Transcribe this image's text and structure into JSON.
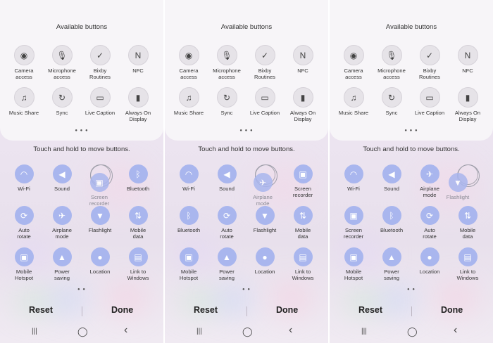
{
  "panels": [
    {
      "available_title": "Available buttons",
      "available": [
        {
          "label": "Camera\naccess",
          "icon": "camera-icon",
          "glyph": "◉"
        },
        {
          "label": "Microphone\naccess",
          "icon": "microphone-icon",
          "glyph": "🎙"
        },
        {
          "label": "Bixby\nRoutines",
          "icon": "bixby-routines-icon",
          "glyph": "✓"
        },
        {
          "label": "NFC",
          "icon": "nfc-icon",
          "glyph": "N"
        },
        {
          "label": "Music Share",
          "icon": "music-share-icon",
          "glyph": "♫"
        },
        {
          "label": "Sync",
          "icon": "sync-icon",
          "glyph": "↻"
        },
        {
          "label": "Live Caption",
          "icon": "live-caption-icon",
          "glyph": "▭"
        },
        {
          "label": "Always On\nDisplay",
          "icon": "always-on-display-icon",
          "glyph": "▮"
        }
      ],
      "hint": "Touch and hold to move buttons.",
      "active": [
        {
          "label": "Wi-Fi",
          "icon": "wifi-icon",
          "glyph": "◠",
          "style": "blue"
        },
        {
          "label": "Sound",
          "icon": "sound-icon",
          "glyph": "◀",
          "style": "blue"
        },
        {
          "label": "",
          "icon": "empty-slot",
          "glyph": "",
          "style": "ghost"
        },
        {
          "label": "Bluetooth",
          "icon": "bluetooth-icon",
          "glyph": "ᛒ",
          "style": "blue"
        },
        {
          "label": "Auto\nrotate",
          "icon": "auto-rotate-icon",
          "glyph": "⟳",
          "style": "blue"
        },
        {
          "label": "Airplane\nmode",
          "icon": "airplane-icon",
          "glyph": "✈",
          "style": "blue"
        },
        {
          "label": "Flashlight",
          "icon": "flashlight-icon",
          "glyph": "▼",
          "style": "blue"
        },
        {
          "label": "Mobile\ndata",
          "icon": "mobile-data-icon",
          "glyph": "⇅",
          "style": "blue"
        },
        {
          "label": "Mobile\nHotspot",
          "icon": "mobile-hotspot-icon",
          "glyph": "▣",
          "style": "blue"
        },
        {
          "label": "Power\nsaving",
          "icon": "power-saving-icon",
          "glyph": "▲",
          "style": "blue"
        },
        {
          "label": "Location",
          "icon": "location-icon",
          "glyph": "●",
          "style": "blue"
        },
        {
          "label": "Link to\nWindows",
          "icon": "link-to-windows-icon",
          "glyph": "▤",
          "style": "blue"
        }
      ],
      "dragging": {
        "label": "Screen\nrecorder",
        "icon": "screen-recorder-icon",
        "glyph": "▣"
      },
      "reset": "Reset",
      "done": "Done"
    },
    {
      "available_title": "Available buttons",
      "available": [
        {
          "label": "Camera\naccess",
          "icon": "camera-icon",
          "glyph": "◉"
        },
        {
          "label": "Microphone\naccess",
          "icon": "microphone-icon",
          "glyph": "🎙"
        },
        {
          "label": "Bixby\nRoutines",
          "icon": "bixby-routines-icon",
          "glyph": "✓"
        },
        {
          "label": "NFC",
          "icon": "nfc-icon",
          "glyph": "N"
        },
        {
          "label": "Music Share",
          "icon": "music-share-icon",
          "glyph": "♫"
        },
        {
          "label": "Sync",
          "icon": "sync-icon",
          "glyph": "↻"
        },
        {
          "label": "Live Caption",
          "icon": "live-caption-icon",
          "glyph": "▭"
        },
        {
          "label": "Always On\nDisplay",
          "icon": "always-on-display-icon",
          "glyph": "▮"
        }
      ],
      "hint": "Touch and hold to move buttons.",
      "active": [
        {
          "label": "Wi-Fi",
          "icon": "wifi-icon",
          "glyph": "◠",
          "style": "blue"
        },
        {
          "label": "Sound",
          "icon": "sound-icon",
          "glyph": "◀",
          "style": "blue"
        },
        {
          "label": "",
          "icon": "empty-slot",
          "glyph": "",
          "style": "ghost"
        },
        {
          "label": "Screen\nrecorder",
          "icon": "screen-recorder-icon",
          "glyph": "▣",
          "style": "blue"
        },
        {
          "label": "Bluetooth",
          "icon": "bluetooth-icon",
          "glyph": "ᛒ",
          "style": "blue"
        },
        {
          "label": "Auto\nrotate",
          "icon": "auto-rotate-icon",
          "glyph": "⟳",
          "style": "blue"
        },
        {
          "label": "Flashlight",
          "icon": "flashlight-icon",
          "glyph": "▼",
          "style": "blue"
        },
        {
          "label": "Mobile\ndata",
          "icon": "mobile-data-icon",
          "glyph": "⇅",
          "style": "blue"
        },
        {
          "label": "Mobile\nHotspot",
          "icon": "mobile-hotspot-icon",
          "glyph": "▣",
          "style": "blue"
        },
        {
          "label": "Power\nsaving",
          "icon": "power-saving-icon",
          "glyph": "▲",
          "style": "blue"
        },
        {
          "label": "Location",
          "icon": "location-icon",
          "glyph": "●",
          "style": "blue"
        },
        {
          "label": "Link to\nWindows",
          "icon": "link-to-windows-icon",
          "glyph": "▤",
          "style": "blue"
        }
      ],
      "dragging": {
        "label": "Airplane\nmode",
        "icon": "airplane-icon",
        "glyph": "✈"
      },
      "reset": "Reset",
      "done": "Done"
    },
    {
      "available_title": "Available buttons",
      "available": [
        {
          "label": "Camera\naccess",
          "icon": "camera-icon",
          "glyph": "◉"
        },
        {
          "label": "Microphone\naccess",
          "icon": "microphone-icon",
          "glyph": "🎙"
        },
        {
          "label": "Bixby\nRoutines",
          "icon": "bixby-routines-icon",
          "glyph": "✓"
        },
        {
          "label": "NFC",
          "icon": "nfc-icon",
          "glyph": "N"
        },
        {
          "label": "Music Share",
          "icon": "music-share-icon",
          "glyph": "♫"
        },
        {
          "label": "Sync",
          "icon": "sync-icon",
          "glyph": "↻"
        },
        {
          "label": "Live Caption",
          "icon": "live-caption-icon",
          "glyph": "▭"
        },
        {
          "label": "Always On\nDisplay",
          "icon": "always-on-display-icon",
          "glyph": "▮"
        }
      ],
      "hint": "Touch and hold to move buttons.",
      "active": [
        {
          "label": "Wi-Fi",
          "icon": "wifi-icon",
          "glyph": "◠",
          "style": "blue"
        },
        {
          "label": "Sound",
          "icon": "sound-icon",
          "glyph": "◀",
          "style": "blue"
        },
        {
          "label": "Airplane\nmode",
          "icon": "airplane-icon",
          "glyph": "✈",
          "style": "blue"
        },
        {
          "label": "",
          "icon": "empty-slot",
          "glyph": "",
          "style": "ghost"
        },
        {
          "label": "Screen\nrecorder",
          "icon": "screen-recorder-icon",
          "glyph": "▣",
          "style": "blue"
        },
        {
          "label": "Bluetooth",
          "icon": "bluetooth-icon",
          "glyph": "ᛒ",
          "style": "blue"
        },
        {
          "label": "Auto\nrotate",
          "icon": "auto-rotate-icon",
          "glyph": "⟳",
          "style": "blue"
        },
        {
          "label": "Mobile\ndata",
          "icon": "mobile-data-icon",
          "glyph": "⇅",
          "style": "blue"
        },
        {
          "label": "Mobile\nHotspot",
          "icon": "mobile-hotspot-icon",
          "glyph": "▣",
          "style": "blue"
        },
        {
          "label": "Power\nsaving",
          "icon": "power-saving-icon",
          "glyph": "▲",
          "style": "blue"
        },
        {
          "label": "Location",
          "icon": "location-icon",
          "glyph": "●",
          "style": "blue"
        },
        {
          "label": "Link to\nWindows",
          "icon": "link-to-windows-icon",
          "glyph": "▤",
          "style": "blue"
        }
      ],
      "dragging": {
        "label": "Flashlight",
        "icon": "flashlight-icon",
        "glyph": "▼"
      },
      "reset": "Reset",
      "done": "Done"
    }
  ],
  "nav": {
    "recents": "|||",
    "home": "◯",
    "back": "‹"
  },
  "colors": {
    "active_button": "#a9b6ee",
    "available_button": "#e6e3e8"
  }
}
